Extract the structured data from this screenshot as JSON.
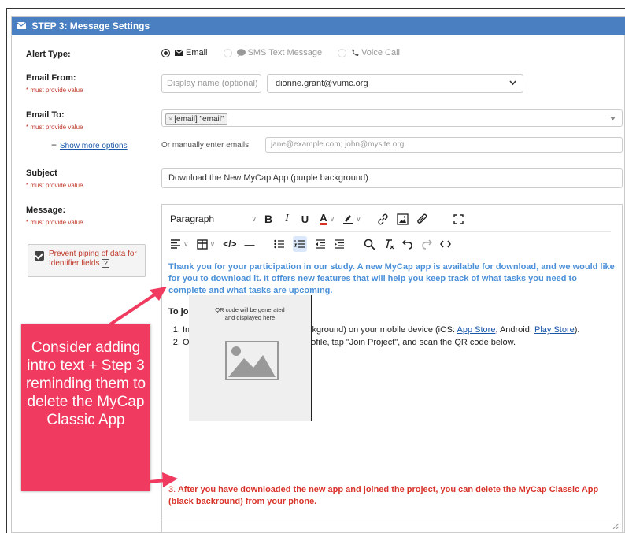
{
  "step": {
    "title": "STEP 3: Message Settings"
  },
  "alert_type": {
    "label": "Alert Type:",
    "options": [
      {
        "label": "Email",
        "checked": true
      },
      {
        "label": "SMS Text Message",
        "checked": false
      },
      {
        "label": "Voice Call",
        "checked": false
      }
    ]
  },
  "email_from": {
    "label": "Email From:",
    "required": "* must provide value",
    "display_name_placeholder": "Display name (optional)",
    "address": "dionne.grant@vumc.org"
  },
  "email_to": {
    "label": "Email To:",
    "required": "* must provide value",
    "tag": "[email] \"email\"",
    "tag_remove": "×",
    "show_more": "Show more options",
    "plus": "+",
    "manual_label": "Or manually enter emails:",
    "manual_placeholder": "jane@example.com; john@mysite.org"
  },
  "subject": {
    "label": "Subject",
    "required": "* must provide value",
    "value": "Download the New MyCap App (purple background)"
  },
  "message": {
    "label": "Message:",
    "required": "* must provide value"
  },
  "piping": {
    "label": "Prevent piping of data for Identifier fields",
    "help": "?",
    "checked": true
  },
  "toolbar": {
    "block_format": "Paragraph",
    "bold": "B",
    "italic": "I",
    "underline": "U",
    "font_color": "A",
    "code": "</>",
    "hr": "—"
  },
  "body": {
    "intro": "Thank you for your participation in our study. A new MyCap app is available for download, and we would like for you to download it. It offers new features that will help you keep track of what tasks you need to complete and what tasks are upcoming.",
    "join_heading": "To join the project on MyCap:",
    "step1_pre": "Install the MyCap app (purple background) on your mobile device (iOS: ",
    "step1_app_store": "App Store",
    "step1_mid": ", Android: ",
    "step1_play_store": "Play Store",
    "step1_post": ").",
    "step2": "Open the MyCap app, create a profile, tap \"Join Project\", and scan the QR code below.",
    "qr_text_1": "QR code will be generated",
    "qr_text_2": "and displayed here",
    "step3_num": "3.",
    "step3": "After you have downloaded the new app and joined the project, you can delete the MyCap Classic App (black backround) from your phone."
  },
  "callout": {
    "text": "Consider adding intro text + Step 3 reminding them to delete the MyCap Classic App"
  },
  "colors": {
    "header": "#4a7fc1",
    "intro_text": "#4a90d9",
    "required": "#c0392b",
    "step3_text": "#d9342b",
    "callout": "#f03a5f"
  }
}
